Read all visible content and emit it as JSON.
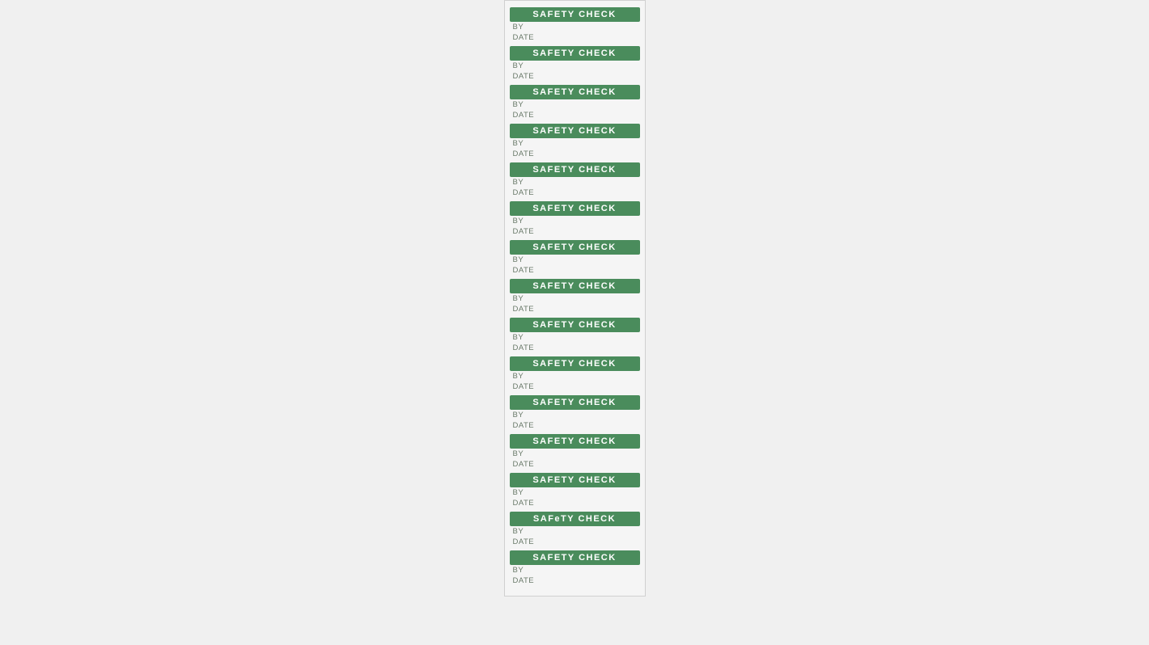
{
  "sheet": {
    "labels": [
      {
        "id": 1,
        "header": "SAFETY CHECK",
        "by_label": "BY",
        "date_label": "DATE"
      },
      {
        "id": 2,
        "header": "SAFETY CHECK",
        "by_label": "BY",
        "date_label": "DATE"
      },
      {
        "id": 3,
        "header": "SAFETY CHECK",
        "by_label": "BY",
        "date_label": "DATE"
      },
      {
        "id": 4,
        "header": "SAFETY CHECK",
        "by_label": "BY",
        "date_label": "DATE"
      },
      {
        "id": 5,
        "header": "SAFETY CHECK",
        "by_label": "BY",
        "date_label": "DATE"
      },
      {
        "id": 6,
        "header": "SAFETY CHECK",
        "by_label": "BY",
        "date_label": "DATE"
      },
      {
        "id": 7,
        "header": "SAFETY CHECK",
        "by_label": "BY",
        "date_label": "DATE"
      },
      {
        "id": 8,
        "header": "SAFETY CHECK",
        "by_label": "BY",
        "date_label": "DATE"
      },
      {
        "id": 9,
        "header": "SAFETY CHECK",
        "by_label": "BY",
        "date_label": "DATE"
      },
      {
        "id": 10,
        "header": "SAFETY CHECK",
        "by_label": "BY",
        "date_label": "DATE"
      },
      {
        "id": 11,
        "header": "SAFETY CHECK",
        "by_label": "BY",
        "date_label": "DATE"
      },
      {
        "id": 12,
        "header": "SAFETY CHECK",
        "by_label": "BY",
        "date_label": "DATE"
      },
      {
        "id": 13,
        "header": "SAFETY CHECK",
        "by_label": "BY",
        "date_label": "DATE"
      },
      {
        "id": 14,
        "header": "SAFeTY CHECK",
        "by_label": "BY",
        "date_label": "DATE"
      },
      {
        "id": 15,
        "header": "SAFETY CHECK",
        "by_label": "BY",
        "date_label": "DATE"
      }
    ],
    "accent_color": "#4a8c5c"
  }
}
